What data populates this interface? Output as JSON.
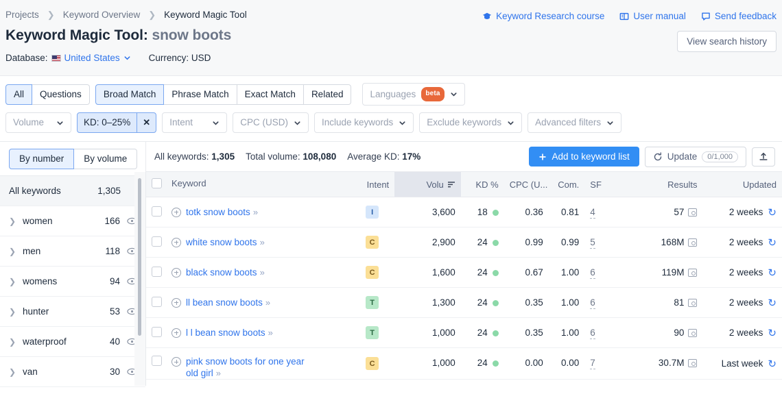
{
  "breadcrumb": [
    {
      "label": "Projects",
      "current": false
    },
    {
      "label": "Keyword Overview",
      "current": false
    },
    {
      "label": "Keyword Magic Tool",
      "current": true
    }
  ],
  "header": {
    "title_prefix": "Keyword Magic Tool:",
    "query": "snow boots",
    "database_label": "Database:",
    "database_value": "United States",
    "currency_label": "Currency: USD",
    "links": [
      {
        "label": "Keyword Research course",
        "icon": "graduation-cap-icon"
      },
      {
        "label": "User manual",
        "icon": "book-icon"
      },
      {
        "label": "Send feedback",
        "icon": "speech-bubble-icon"
      }
    ],
    "search_history_button": "View search history"
  },
  "filters": {
    "match_tabs": [
      {
        "label": "All",
        "active": true
      },
      {
        "label": "Questions",
        "active": false
      }
    ],
    "match_types": [
      {
        "label": "Broad Match",
        "active": true
      },
      {
        "label": "Phrase Match",
        "active": false
      },
      {
        "label": "Exact Match",
        "active": false
      },
      {
        "label": "Related",
        "active": false
      }
    ],
    "languages": {
      "label": "Languages",
      "badge": "beta"
    },
    "dropdowns": [
      {
        "label": "Volume",
        "active": false
      },
      {
        "label": "Intent",
        "active": false
      },
      {
        "label": "CPC (USD)",
        "active": false
      },
      {
        "label": "Include keywords",
        "active": false
      },
      {
        "label": "Exclude keywords",
        "active": false
      },
      {
        "label": "Advanced filters",
        "active": false
      }
    ],
    "kd_chip": {
      "label": "KD: 0–25%",
      "close": "✕"
    }
  },
  "sidebar": {
    "toggle": [
      {
        "label": "By number",
        "active": true
      },
      {
        "label": "By volume",
        "active": false
      }
    ],
    "all_keywords": {
      "label": "All keywords",
      "count": "1,305"
    },
    "groups": [
      {
        "label": "women",
        "count": "166"
      },
      {
        "label": "men",
        "count": "118"
      },
      {
        "label": "womens",
        "count": "94"
      },
      {
        "label": "hunter",
        "count": "53"
      },
      {
        "label": "waterproof",
        "count": "40"
      },
      {
        "label": "van",
        "count": "30"
      }
    ]
  },
  "toolbar": {
    "stats": [
      {
        "label": "All keywords:",
        "value": "1,305"
      },
      {
        "label": "Total volume:",
        "value": "108,080"
      },
      {
        "label": "Average KD:",
        "value": "17%"
      }
    ],
    "add_button": "Add to keyword list",
    "update_button": "Update",
    "update_count": "0/1,000",
    "export_icon": "export-icon"
  },
  "table": {
    "columns": [
      {
        "key": "keyword",
        "label": "Keyword",
        "align": "left"
      },
      {
        "key": "intent",
        "label": "Intent",
        "align": "right"
      },
      {
        "key": "volume",
        "label": "Volu",
        "align": "right",
        "sorted": true
      },
      {
        "key": "kd",
        "label": "KD %",
        "align": "right"
      },
      {
        "key": "cpc",
        "label": "CPC (U...",
        "align": "right"
      },
      {
        "key": "com",
        "label": "Com.",
        "align": "right"
      },
      {
        "key": "sf",
        "label": "SF",
        "align": "left"
      },
      {
        "key": "results",
        "label": "Results",
        "align": "right"
      },
      {
        "key": "updated",
        "label": "Updated",
        "align": "right"
      }
    ],
    "rows": [
      {
        "keyword": "totk snow boots",
        "intent": "I",
        "volume": "3,600",
        "kd": "18",
        "kd_color": "#8bd9a8",
        "cpc": "0.36",
        "com": "0.81",
        "sf": "4",
        "results": "57",
        "updated": "2 weeks"
      },
      {
        "keyword": "white snow boots",
        "intent": "C",
        "volume": "2,900",
        "kd": "24",
        "kd_color": "#8bd9a8",
        "cpc": "0.99",
        "com": "0.99",
        "sf": "5",
        "results": "168M",
        "updated": "2 weeks"
      },
      {
        "keyword": "black snow boots",
        "intent": "C",
        "volume": "1,600",
        "kd": "24",
        "kd_color": "#8bd9a8",
        "cpc": "0.67",
        "com": "1.00",
        "sf": "6",
        "results": "119M",
        "updated": "2 weeks"
      },
      {
        "keyword": "ll bean snow boots",
        "intent": "T",
        "volume": "1,300",
        "kd": "24",
        "kd_color": "#8bd9a8",
        "cpc": "0.35",
        "com": "1.00",
        "sf": "6",
        "results": "81",
        "updated": "2 weeks"
      },
      {
        "keyword": "l l bean snow boots",
        "intent": "T",
        "volume": "1,000",
        "kd": "24",
        "kd_color": "#8bd9a8",
        "cpc": "0.35",
        "com": "1.00",
        "sf": "6",
        "results": "90",
        "updated": "2 weeks"
      },
      {
        "keyword": "pink snow boots for one year old girl",
        "intent": "C",
        "volume": "1,000",
        "kd": "24",
        "kd_color": "#8bd9a8",
        "cpc": "0.00",
        "com": "0.00",
        "sf": "7",
        "results": "30.7M",
        "updated": "Last week"
      }
    ]
  },
  "colors": {
    "accent": "#328ef4",
    "link": "#2f74eb",
    "beta_badge": "#e8683a",
    "sorted_header": "#e3e6ed"
  }
}
